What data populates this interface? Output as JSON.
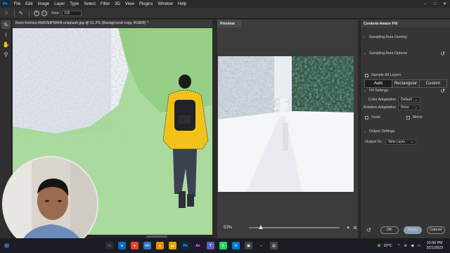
{
  "app": {
    "logo": "Ps"
  },
  "menu": [
    "File",
    "Edit",
    "Image",
    "Layer",
    "Type",
    "Select",
    "Filter",
    "3D",
    "View",
    "Plugins",
    "Window",
    "Help"
  ],
  "options_bar": {
    "size_label": "Size:",
    "size_value": "118"
  },
  "document": {
    "tab_title": "thom-holmes-RbR2kfPM4rB-unsplash.jpg @ 51.2% (Background copy, RGB/8) *"
  },
  "preview": {
    "tab_label": "Preview",
    "zoom": "53%"
  },
  "caf": {
    "title": "Content-Aware Fill",
    "sampling_overlay": "Sampling Area Overlay",
    "sampling_options": "Sampling Area Options",
    "modes": [
      "Auto",
      "Rectangular",
      "Custom"
    ],
    "selected_mode": "Auto",
    "sample_all_layers": "Sample All Layers",
    "fill_settings": "Fill Settings",
    "color_adaptation_label": "Color Adaptation",
    "color_adaptation_value": "Default",
    "rotation_adaptation_label": "Rotation Adaptation",
    "rotation_adaptation_value": "None",
    "scale": "Scale",
    "mirror": "Mirror",
    "output_settings": "Output Settings",
    "output_to_label": "Output To:",
    "output_to_value": "New Layer",
    "ok_label": "OK",
    "apply_label": "Apply",
    "cancel_label": "Cancel"
  },
  "taskbar": {
    "weather": "20°C",
    "time": "10:50 PM",
    "date": "3/21/2023"
  },
  "colors": {
    "selection_overlay": "#9fd68f",
    "jacket": "#f2c21b",
    "apply_button": "#8b9db5"
  }
}
